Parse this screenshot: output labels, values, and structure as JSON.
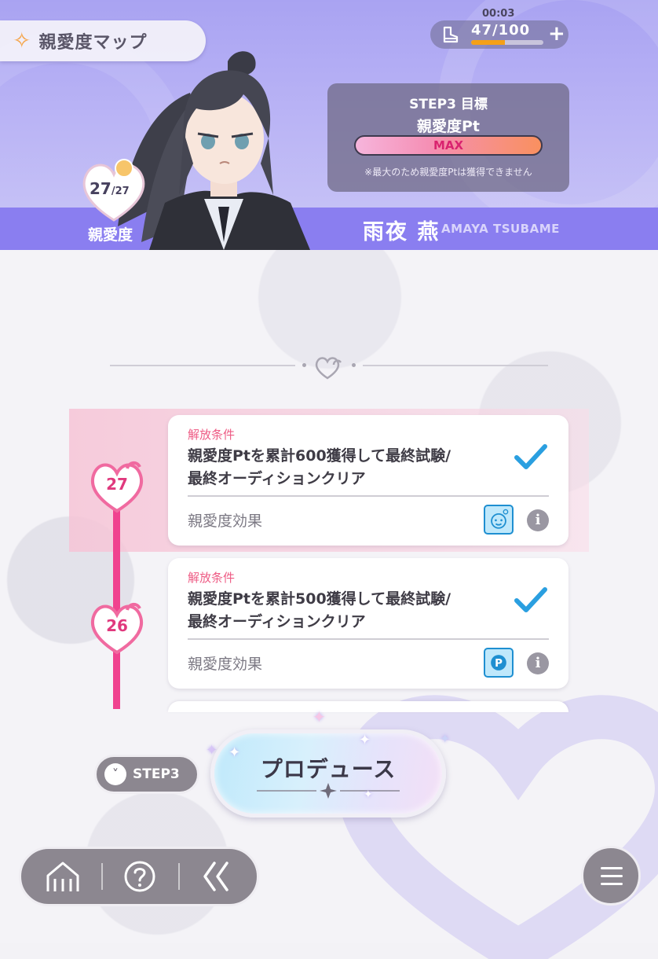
{
  "header": {
    "title": "親愛度マップ",
    "stamina_timer": "00:03",
    "stamina_count": "47/100",
    "stamina_fraction": 0.47,
    "stamina_plus": "+"
  },
  "step_goal": {
    "title": "STEP3 目標",
    "subtitle": "親愛度Pt",
    "status": "MAX",
    "note": "※最大のため親愛度Ptは獲得できません"
  },
  "character": {
    "name_jp": "雨夜 燕",
    "name_en": "AMAYA TSUBAME",
    "affinity_current": "27",
    "affinity_max": "/27",
    "affinity_label": "親愛度"
  },
  "levels": [
    {
      "level": "27",
      "condition_label": "解放条件",
      "condition_line1": "親愛度Ptを累計600獲得して最終試験/",
      "condition_line2": "最終オーディションクリア",
      "effect_label": "親愛度効果",
      "effect_icon": "face-icon",
      "completed": true
    },
    {
      "level": "26",
      "condition_label": "解放条件",
      "condition_line1": "親愛度Ptを累計500獲得して最終試験/",
      "condition_line2": "最終オーディションクリア",
      "effect_label": "親愛度効果",
      "effect_icon": "p-item-icon",
      "completed": true
    }
  ],
  "controls": {
    "step_toggle": "STEP3",
    "produce_label": "プロデュース",
    "info_glyph": "i"
  },
  "colors": {
    "accent_purple": "#8a7ef0",
    "accent_pink": "#f0428f",
    "check_blue": "#2a9fe0",
    "stamina_orange": "#f5a017"
  }
}
